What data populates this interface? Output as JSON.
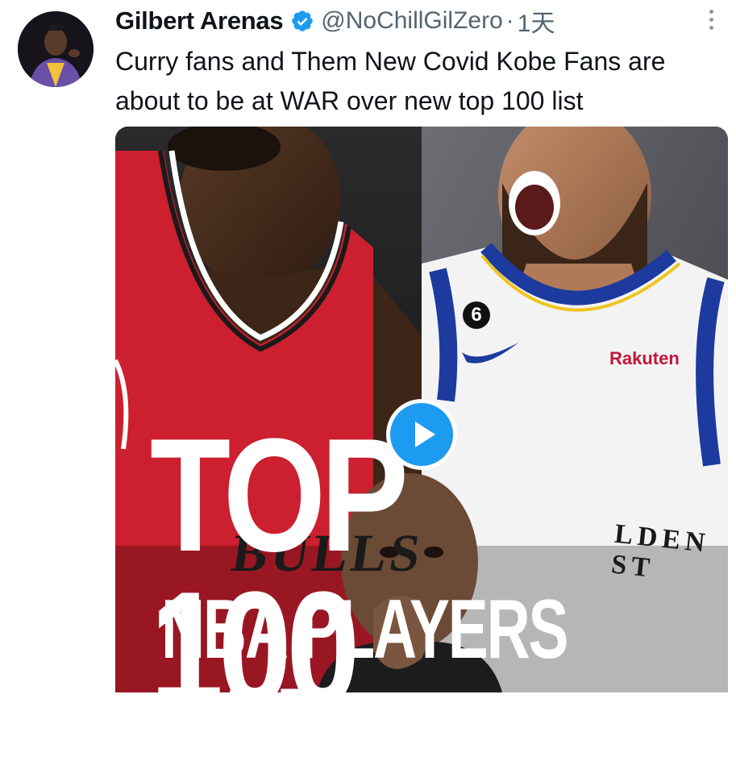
{
  "tweet": {
    "author_name": "Gilbert Arenas",
    "handle": "@NoChillGilZero",
    "separator": "·",
    "time": "1天",
    "text": "Curry fans and Them New Covid Kobe Fans are about to be at WAR over new top 100 list"
  },
  "media": {
    "overlay_line1": "TOP 100",
    "overlay_line2": "NBA PLAYERS EVER",
    "jersey_left_text": "BULLS",
    "jersey_right_text": "LDEN ST",
    "jersey_number": "6",
    "sponsor": "Rakuten"
  },
  "icons": {
    "verified": "verified-badge-icon",
    "more": "more-options-icon",
    "play": "play-icon"
  },
  "colors": {
    "verified_blue": "#1d9bf0",
    "secondary_text": "#536471",
    "bulls_red": "#cc1f2f",
    "warriors_blue": "#1d3a9e",
    "rakuten_red": "#c3163a"
  }
}
